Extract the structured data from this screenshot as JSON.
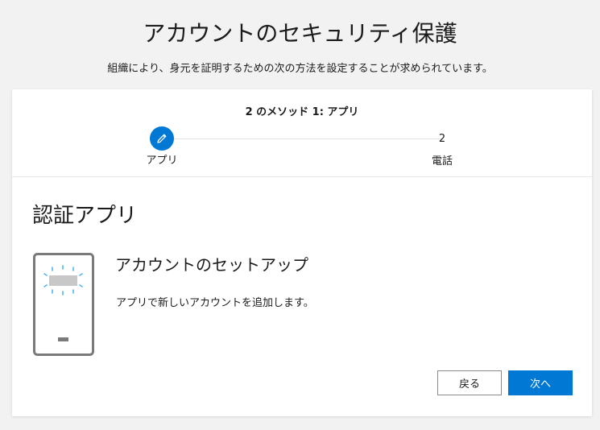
{
  "page": {
    "title": "アカウントのセキュリティ保護",
    "subtitle": "組織により、身元を証明するための次の方法を設定することが求められています。"
  },
  "stepper": {
    "caption": "2 のメソッド 1: アプリ",
    "steps": [
      {
        "number": "1",
        "label": "アプリ",
        "state": "current",
        "icon": "pencil-icon"
      },
      {
        "number": "2",
        "label": "電話",
        "state": "pending"
      }
    ]
  },
  "section": {
    "title": "認証アプリ",
    "setup_title": "アカウントのセットアップ",
    "setup_description": "アプリで新しいアカウントを追加します。"
  },
  "buttons": {
    "back": "戻る",
    "next": "次へ"
  },
  "colors": {
    "accent": "#0078d4",
    "background": "#f2f2f2",
    "card": "#ffffff"
  }
}
